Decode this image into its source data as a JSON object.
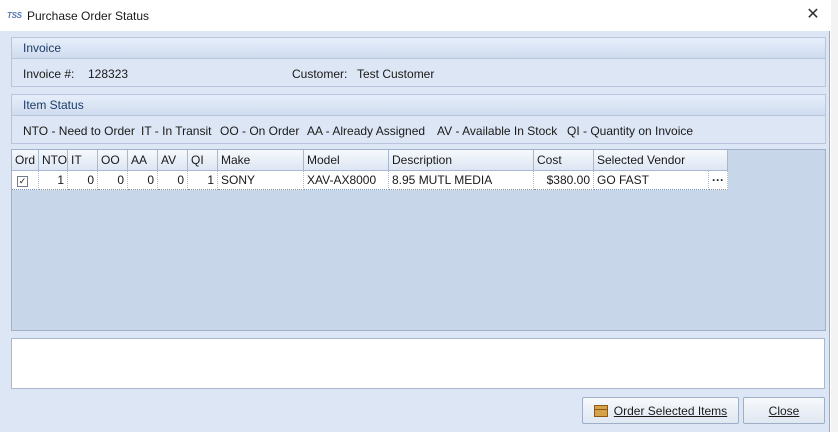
{
  "window": {
    "app_icon": "TSS",
    "title": "Purchase Order Status",
    "close_glyph": "✕"
  },
  "invoice": {
    "header": "Invoice",
    "invoice_label": "Invoice #:",
    "invoice_number": "128323",
    "customer_label": "Customer:",
    "customer_name": "Test Customer"
  },
  "item_status": {
    "header": "Item Status",
    "legend": [
      "NTO - Need to Order",
      "IT - In Transit",
      "OO - On Order",
      "AA - Already Assigned",
      "AV - Available In Stock",
      "QI - Quantity on Invoice"
    ]
  },
  "grid": {
    "columns": [
      "Ord",
      "NTO",
      "IT",
      "OO",
      "AA",
      "AV",
      "QI",
      "Make",
      "Model",
      "Description",
      "Cost",
      "Selected Vendor"
    ],
    "rows": [
      {
        "ord": "✓",
        "nto": "1",
        "it": "0",
        "oo": "0",
        "aa": "0",
        "av": "0",
        "qi": "1",
        "make": "SONY",
        "model": "XAV-AX8000",
        "description": "8.95 MUTL MEDIA",
        "cost": "$380.00",
        "vendor": "GO FAST",
        "ellipsis": "···"
      }
    ]
  },
  "memo": {
    "value": ""
  },
  "buttons": {
    "order_selected": "Order Selected Items",
    "close": "Close"
  },
  "icons": {
    "close": "close-icon",
    "order": "package-icon",
    "ellipsis": "ellipsis-icon",
    "checkbox": "checkbox-checked-icon"
  }
}
